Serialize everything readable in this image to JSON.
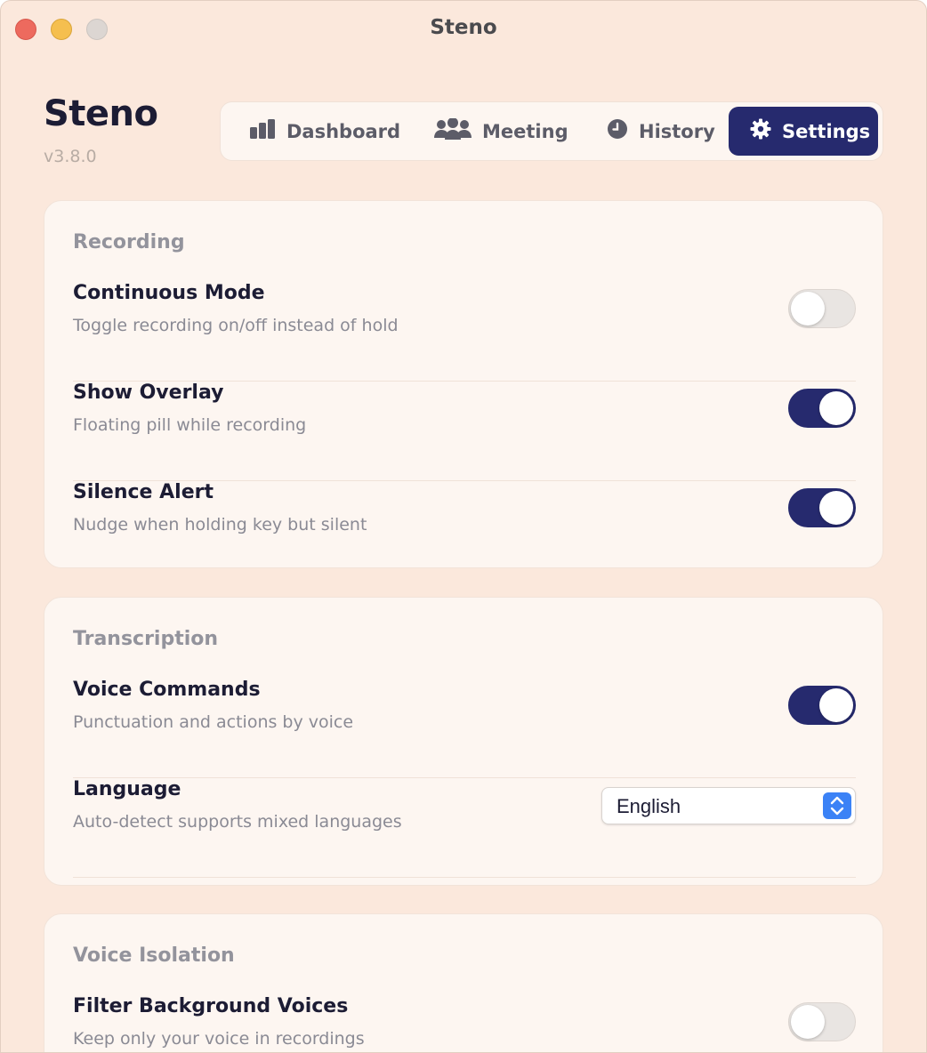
{
  "window": {
    "title": "Steno"
  },
  "app": {
    "name": "Steno",
    "version": "v3.8.0"
  },
  "nav": {
    "tabs": [
      {
        "label": "Dashboard",
        "icon": "bar-chart-icon",
        "active": false
      },
      {
        "label": "Meeting",
        "icon": "people-icon",
        "active": false
      },
      {
        "label": "History",
        "icon": "clock-icon",
        "active": false
      },
      {
        "label": "Settings",
        "icon": "gear-icon",
        "active": true
      }
    ]
  },
  "sections": {
    "recording": {
      "title": "Recording",
      "rows": [
        {
          "title": "Continuous Mode",
          "desc": "Toggle recording on/off instead of hold",
          "on": false
        },
        {
          "title": "Show Overlay",
          "desc": "Floating pill while recording",
          "on": true
        },
        {
          "title": "Silence Alert",
          "desc": "Nudge when holding key but silent",
          "on": true
        }
      ]
    },
    "transcription": {
      "title": "Transcription",
      "rows": [
        {
          "title": "Voice Commands",
          "desc": "Punctuation and actions by voice",
          "on": true
        },
        {
          "title": "Language",
          "desc": "Auto-detect supports mixed languages",
          "value": "English"
        }
      ]
    },
    "voice_isolation": {
      "title": "Voice Isolation",
      "rows": [
        {
          "title": "Filter Background Voices",
          "desc": "Keep only your voice in recordings",
          "on": false
        }
      ]
    }
  },
  "colors": {
    "accent": "#262a6e",
    "background": "#fbe8dc",
    "card": "#fdf6f1"
  }
}
